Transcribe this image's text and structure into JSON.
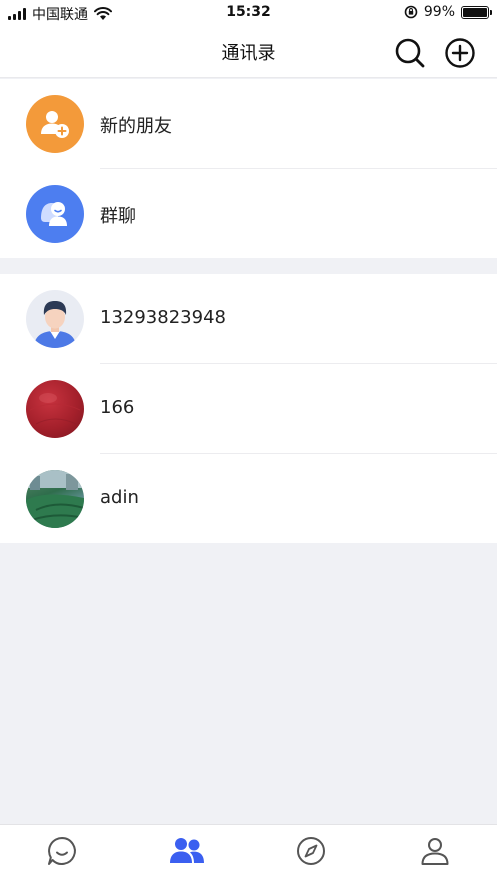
{
  "status_bar": {
    "carrier": "中国联通",
    "time": "15:32",
    "battery_percent": "99%",
    "battery_level": 0.99,
    "icons": [
      "signal-icon",
      "wifi-icon",
      "orientation-lock-icon",
      "battery-icon"
    ]
  },
  "header": {
    "title": "通讯录",
    "icons": [
      "search-icon",
      "add-circle-icon"
    ]
  },
  "shortcuts": [
    {
      "label": "新的朋友",
      "icon": "add-friend-icon",
      "color": "#f39a3a"
    },
    {
      "label": "群聊",
      "icon": "group-chat-icon",
      "color": "#4d7ef0"
    }
  ],
  "contacts": [
    {
      "name": "13293823948",
      "avatar": "default-user-avatar"
    },
    {
      "name": "166",
      "avatar": "red-ball-avatar"
    },
    {
      "name": "adin",
      "avatar": "photo-avatar"
    }
  ],
  "tabbar": {
    "active": "contacts",
    "active_color": "#3b5ff0",
    "inactive_color": "#555555",
    "tabs": [
      "chat-icon",
      "contacts-icon",
      "compass-icon",
      "profile-icon"
    ]
  }
}
